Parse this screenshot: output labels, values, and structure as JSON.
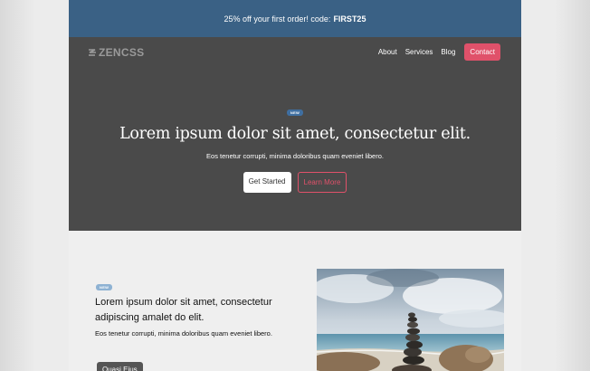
{
  "promo": {
    "text": "25% off your first order! code:",
    "code": "FIRST25"
  },
  "nav": {
    "logo": "ZENCSS",
    "links": [
      "About",
      "Services",
      "Blog"
    ],
    "cta": "Contact"
  },
  "hero": {
    "badge": "NEW",
    "title": "Lorem ipsum dolor sit amet, consectetur elit.",
    "subtitle": "Eos tenetur corrupti, minima doloribus quam eveniet libero.",
    "primary_button": "Get Started",
    "secondary_button": "Learn More"
  },
  "feature": {
    "badge": "NEW",
    "title": "Lorem ipsum dolor sit amet, consectetur adipiscing amalet do elit.",
    "body": "Eos tenetur corrupti, minima doloribus quam eveniet libero.",
    "button": "Quasi Eius",
    "image_icon": "stacked-stones-beach-photo"
  },
  "colors": {
    "promo_bg": "#3a6185",
    "nav_bg": "#4a4a4a",
    "accent": "#e0516a",
    "badge": "#3f6fa1"
  }
}
